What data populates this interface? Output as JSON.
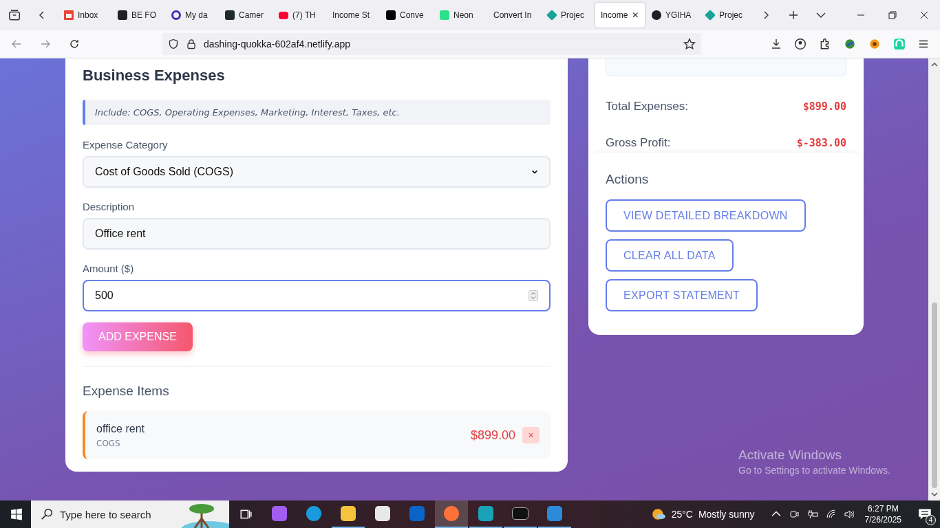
{
  "browser": {
    "tabs": [
      {
        "label": "Inbox",
        "kind": "mail",
        "selected": false
      },
      {
        "label": "BE FO",
        "kind": "dark",
        "selected": false
      },
      {
        "label": "My da",
        "kind": "ring",
        "selected": false
      },
      {
        "label": "Camer",
        "kind": "bolt",
        "selected": false
      },
      {
        "label": "(7) TH",
        "kind": "play",
        "selected": false
      },
      {
        "label": "Income St",
        "kind": "plain",
        "selected": false
      },
      {
        "label": "Conve",
        "kind": "b",
        "selected": false
      },
      {
        "label": "Neon",
        "kind": "n",
        "selected": false
      },
      {
        "label": "Convert In",
        "kind": "plain",
        "selected": false
      },
      {
        "label": "Projec",
        "kind": "diamond",
        "selected": false
      },
      {
        "label": "Income",
        "kind": "plain",
        "selected": true
      },
      {
        "label": "YGIHA",
        "kind": "github",
        "selected": false
      },
      {
        "label": "Projec",
        "kind": "diamond",
        "selected": false
      }
    ],
    "close_tab": "✕",
    "url": "dashing-quokka-602af4.netlify.app"
  },
  "expenses_card": {
    "title": "Business Expenses",
    "hint": "Include: COGS, Operating Expenses, Marketing, Interest, Taxes, etc.",
    "fields": [
      {
        "label": "Expense Category",
        "kind": "select",
        "value": "Cost of Goods Sold (COGS)",
        "focused": false
      },
      {
        "label": "Description",
        "kind": "text",
        "value": "Office rent",
        "focused": false
      },
      {
        "label": "Amount ($)",
        "kind": "number",
        "value": "500",
        "focused": true
      }
    ],
    "add_button": "ADD EXPENSE",
    "items_title": "Expense Items",
    "items": [
      {
        "name": "office rent",
        "category": "COGS",
        "amount": "$899.00",
        "remove": "×",
        "color": "#f28c28"
      }
    ]
  },
  "summary_card": {
    "rows": [
      {
        "label": "Total Expenses:",
        "value": "$899.00"
      },
      {
        "label": "Gross Profit:",
        "value": "$-383.00"
      }
    ],
    "actions_title": "Actions",
    "actions": [
      "VIEW DETAILED BREAKDOWN",
      "CLEAR ALL DATA",
      "EXPORT STATEMENT"
    ]
  },
  "os_notice": {
    "title": "Activate Windows",
    "text": "Go to Settings to activate Windows."
  },
  "taskbar": {
    "search_placeholder": "Type here to search",
    "apps": [
      {
        "kind": "copilot",
        "running": false,
        "active": false
      },
      {
        "kind": "edge",
        "running": false,
        "active": false
      },
      {
        "kind": "folder",
        "running": true,
        "active": false
      },
      {
        "kind": "store",
        "running": false,
        "active": false
      },
      {
        "kind": "outlook",
        "running": false,
        "active": false
      },
      {
        "kind": "firefox",
        "running": true,
        "active": true
      },
      {
        "kind": "v",
        "running": true,
        "active": false
      },
      {
        "kind": "terminal",
        "running": true,
        "active": false
      },
      {
        "kind": "vscode",
        "running": true,
        "active": false
      }
    ],
    "temperature": "25°C",
    "weather": "Mostly sunny",
    "time": "6:27 PM",
    "date": "7/26/2025",
    "notifications": "4"
  }
}
